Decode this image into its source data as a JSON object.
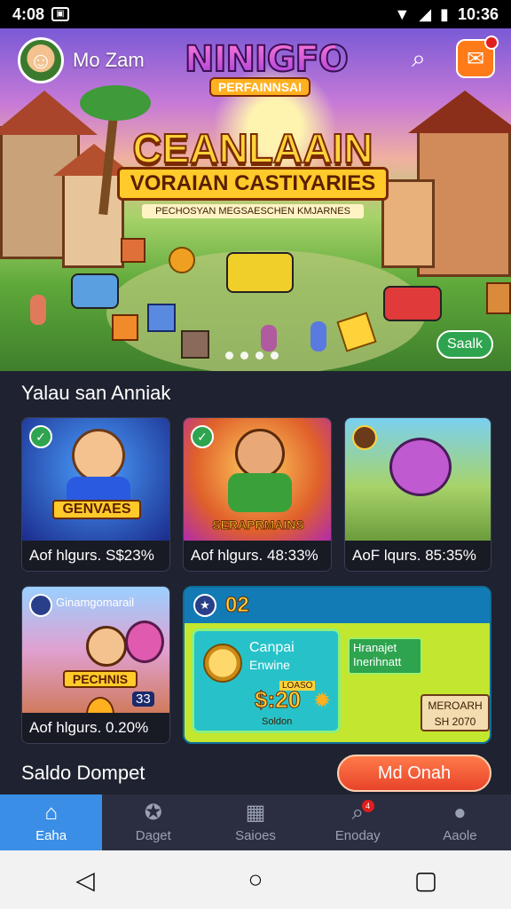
{
  "status_bar": {
    "time_left": "4:08",
    "time_right": "10:36"
  },
  "header": {
    "username": "Mo Zam",
    "logo_title": "NINIGFO",
    "logo_sub": "PERFAINNSAI"
  },
  "banner": {
    "title": "CEANLAAIN",
    "ribbon": "VORAIAN CASTIYARIES",
    "subtitle": "PECHOSYAN MEGSAESCHEN KMJARNES",
    "button": "Saalk",
    "dots": 4
  },
  "section_title": "Yalau san Anniak",
  "cards": [
    {
      "label": "GENVAES",
      "caption": "Aof hlgurs. S$23%"
    },
    {
      "label": "SERAPRMAINS",
      "caption": "Aof hlgurs. 48:33%"
    },
    {
      "label": "",
      "caption": "AoF lqurs. 85:35%"
    },
    {
      "label": "PECHNIS",
      "top_text": "Ginamgomarail",
      "score": "33",
      "caption": "Aof hlgurs. 0.20%"
    }
  ],
  "promo": {
    "header": "02",
    "box_title": "Canpai",
    "box_sub": "Enwine",
    "amount": "$:20",
    "amount_top": "LOASO",
    "amount_bottom": "Soldon",
    "tag_line1": "Hranajet",
    "tag_line2": "Inerihnatt",
    "badge_line1": "MEROARH",
    "badge_line2": "SH 2070"
  },
  "wallet": {
    "title": "Saldo Dompet",
    "button": "Md Onah"
  },
  "tabs": [
    {
      "label": "Eaha",
      "icon": "home-icon"
    },
    {
      "label": "Daget",
      "icon": "star-circle-icon"
    },
    {
      "label": "Saioes",
      "icon": "calendar-icon"
    },
    {
      "label": "Enoday",
      "icon": "search-badge-icon",
      "badge": "4"
    },
    {
      "label": "Aaole",
      "icon": "user-icon"
    }
  ]
}
